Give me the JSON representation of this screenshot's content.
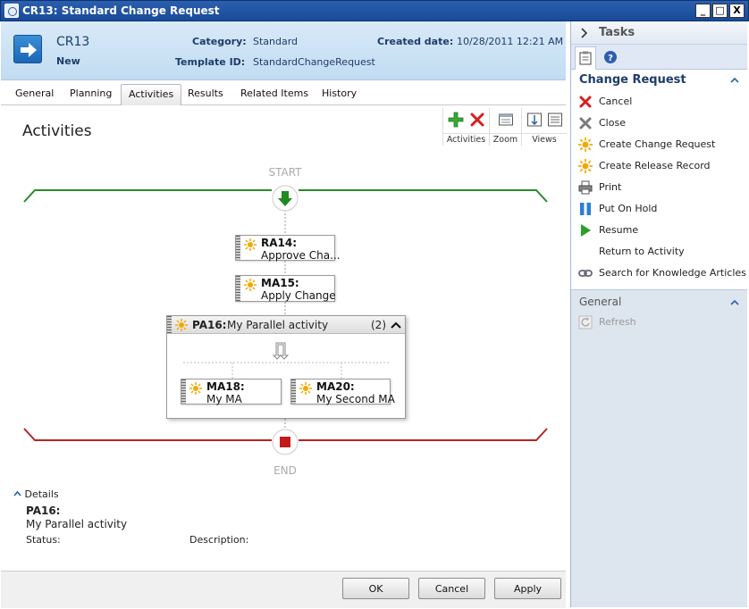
{
  "window": {
    "title": "CR13: Standard Change Request",
    "minimize": "_",
    "maximize": "□",
    "close": "X"
  },
  "header": {
    "id": "CR13",
    "status": "New",
    "category_label": "Category:",
    "category_value": "Standard",
    "template_label": "Template ID:",
    "template_value": "StandardChangeRequest",
    "created_label": "Created date:",
    "created_value": "10/28/2011 12:21 AM"
  },
  "tabs": [
    {
      "label": "General"
    },
    {
      "label": "Planning"
    },
    {
      "label": "Activities",
      "active": true
    },
    {
      "label": "Results"
    },
    {
      "label": "Related Items"
    },
    {
      "label": "History"
    }
  ],
  "main": {
    "title": "Activities",
    "toolbar": {
      "activities": "Activities",
      "zoom": "Zoom",
      "views": "Views"
    },
    "start_label": "START",
    "end_label": "END",
    "nodes": [
      {
        "id": "RA14:",
        "name": "Approve Cha..."
      },
      {
        "id": "MA15:",
        "name": "Apply Change"
      }
    ],
    "parallel": {
      "id": "PA16:",
      "name": "My Parallel activity",
      "count": "(2)",
      "children": [
        {
          "id": "MA18:",
          "name": "My MA"
        },
        {
          "id": "MA20:",
          "name": "My Second MA"
        }
      ]
    },
    "details": {
      "toggle_label": "Details",
      "id": "PA16:",
      "name": "My Parallel activity",
      "status_label": "Status:",
      "description_label": "Description:"
    }
  },
  "footer": {
    "ok": "OK",
    "cancel": "Cancel",
    "apply": "Apply"
  },
  "tasks": {
    "header": "Tasks",
    "section_title": "Change Request",
    "items": [
      {
        "label": "Cancel",
        "icon": "red-x-icon"
      },
      {
        "label": "Close",
        "icon": "gray-x-icon"
      },
      {
        "label": "Create Change Request",
        "icon": "sun-icon"
      },
      {
        "label": "Create Release Record",
        "icon": "sun-icon"
      },
      {
        "label": "Print",
        "icon": "printer-icon"
      },
      {
        "label": "Put On Hold",
        "icon": "pause-icon"
      },
      {
        "label": "Resume",
        "icon": "play-icon"
      },
      {
        "label": "Return to Activity",
        "icon": "none"
      },
      {
        "label": "Search for Knowledge Articles",
        "icon": "link-icon"
      }
    ],
    "general_title": "General",
    "refresh": "Refresh"
  }
}
